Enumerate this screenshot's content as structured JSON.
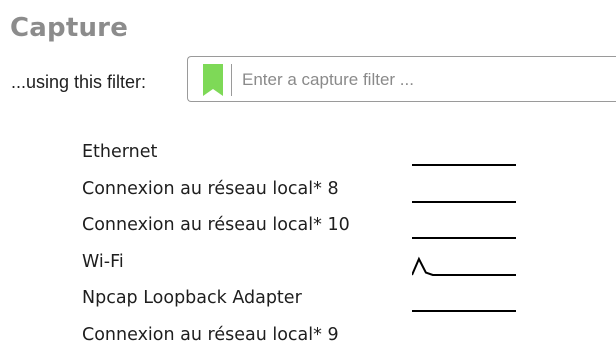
{
  "capture": {
    "title": "Capture",
    "filter": {
      "label": "...using this filter:",
      "placeholder": "Enter a capture filter ...",
      "value": "",
      "bookmark_color": "#7ed957"
    },
    "interfaces": [
      {
        "name": "Ethernet",
        "sparkline": [
          0,
          0,
          0,
          0,
          0,
          0,
          0,
          0,
          0,
          0,
          0,
          0,
          0,
          0,
          0,
          0
        ]
      },
      {
        "name": "Connexion au réseau local* 8",
        "sparkline": [
          0,
          0,
          0,
          0,
          0,
          0,
          0,
          0,
          0,
          0,
          0,
          0,
          0,
          0,
          0,
          0
        ]
      },
      {
        "name": "Connexion au réseau local* 10",
        "sparkline": [
          0,
          0,
          0,
          0,
          0,
          0,
          0,
          0,
          0,
          0,
          0,
          0,
          0,
          0,
          0,
          0
        ]
      },
      {
        "name": "Wi-Fi",
        "sparkline": [
          0,
          1,
          0.15,
          0,
          0,
          0,
          0,
          0,
          0,
          0,
          0,
          0,
          0,
          0,
          0,
          0
        ]
      },
      {
        "name": "Npcap Loopback Adapter",
        "sparkline": [
          0,
          0,
          0,
          0,
          0,
          0,
          0,
          0,
          0,
          0,
          0,
          0,
          0,
          0,
          0,
          0
        ]
      },
      {
        "name": "Connexion au réseau local* 9",
        "sparkline": null
      }
    ]
  }
}
